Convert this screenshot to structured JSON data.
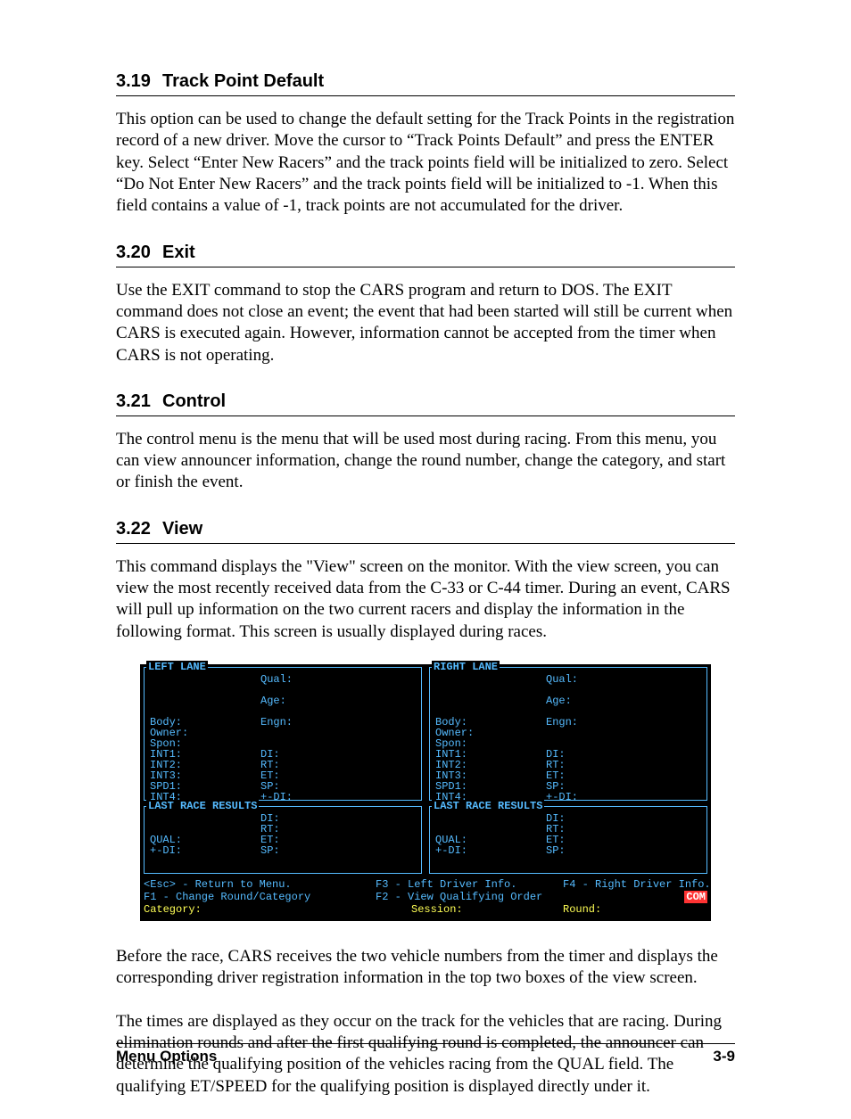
{
  "sections": {
    "s319": {
      "num": "3.19",
      "title": "Track Point Default",
      "body": "This option can be used to change the default setting for the Track Points in the registration record of a new driver. Move the cursor to “Track Points Default” and press the ENTER key. Select “Enter New Racers” and the track points field will be initialized to zero. Select “Do Not Enter New Racers” and the track points field will be initialized to -1. When this field contains a value of -1, track points are not accumulated for the driver."
    },
    "s320": {
      "num": "3.20",
      "title": "Exit",
      "body": "Use the EXIT command to stop the CARS program and return to DOS. The EXIT command does not close an event; the event that had been started will still be current when CARS is executed again. However, information cannot be accepted from the timer when CARS is not operating."
    },
    "s321": {
      "num": "3.21",
      "title": "Control",
      "body": "The control menu is the menu that will be used most during racing. From this menu, you can view announcer information, change the round number, change the category, and start or finish the event."
    },
    "s322": {
      "num": "3.22",
      "title": "View",
      "body": "This command displays the \"View\" screen on the monitor. With the view screen, you can view the most recently received data from the C-33 or C-44 timer. During an event, CARS will pull up information on the two current racers and display the information in the following format. This screen is usually displayed during races."
    }
  },
  "after_image": {
    "p1": "Before the race, CARS receives the two vehicle numbers from the timer and displays the corresponding driver registration information in the top two boxes of the view screen.",
    "p2": "The times are displayed as they occur on the track for the vehicles that are racing. During elimination rounds and after the first qualifying round is completed, the announcer can determine the qualifying position of the vehicles racing from the QUAL field. The qualifying ET/SPEED for the qualifying position is displayed directly under it."
  },
  "dos": {
    "left_title": "LEFT LANE",
    "right_title": "RIGHT LANE",
    "results_title": "LAST RACE RESULTS",
    "fields_left": [
      "Body:",
      "Owner:",
      "Spon:",
      "INT1:",
      "INT2:",
      "INT3:",
      "SPD1:",
      "INT4:"
    ],
    "fields_right_top": [
      "Qual:",
      "Age:",
      "Engn:"
    ],
    "fields_right_bottom": [
      "DI:",
      "RT:",
      "ET:",
      "SP:",
      "+-DI:"
    ],
    "results_left": [
      "QUAL:",
      "+-DI:"
    ],
    "results_right": [
      "DI:",
      "RT:",
      "ET:",
      "SP:"
    ],
    "footer": {
      "esc": "<Esc> - Return to Menu.",
      "f1": "F1 - Change Round/Category",
      "f2": "F2 - View Qualifying Order",
      "f3": "F3 - Left Driver Info.",
      "f4": "F4 - Right Driver Info.",
      "category": "Category:",
      "session": "Session:",
      "round": "Round:",
      "com": "COM"
    }
  },
  "page_footer": {
    "left": "Menu Options",
    "right": "3-9"
  }
}
